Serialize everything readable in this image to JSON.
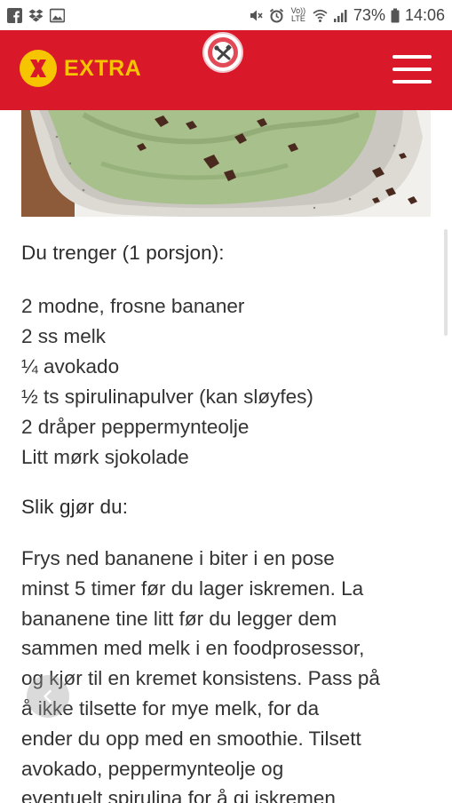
{
  "status_bar": {
    "left_icons": [
      "facebook-icon",
      "dropbox-icon",
      "gallery-icon"
    ],
    "right_icons": [
      "mute-icon",
      "alarm-icon",
      "volte-icon",
      "wifi-icon",
      "signal-icon",
      "battery-icon"
    ],
    "volte_label": "Vo)) LTE",
    "battery": "73%",
    "time": "14:06"
  },
  "header": {
    "brand": "EXTRA",
    "brand_color": "#f6c400",
    "background_color": "#d9192a",
    "center_icon": "no-tools-badge-icon",
    "menu_icon": "hamburger-menu-icon"
  },
  "recipe": {
    "ingredients_title": "Du trenger (1 porsjon):",
    "ingredients": [
      "2 modne, frosne bananer",
      "2 ss melk",
      "¼ avokado",
      "½ ts spirulinapulver (kan sløyfes)",
      "2 dråper peppermynteolje",
      "Litt mørk sjokolade"
    ],
    "method_title": "Slik gjør du:",
    "method_lines": [
      "Frys ned bananene i biter i en pose",
      "minst 5 timer før du lager iskremen. La",
      "bananene tine litt før du legger dem",
      "sammen med melk i en foodprosessor,",
      "og kjør til en kremet konsistens. Pass på",
      "å ikke tilsette for mye melk, for da",
      "ender du opp med en smoothie. Tilsett",
      "avokado, peppermynteolje og",
      "eventuelt spirulina for å gi iskremen"
    ]
  }
}
